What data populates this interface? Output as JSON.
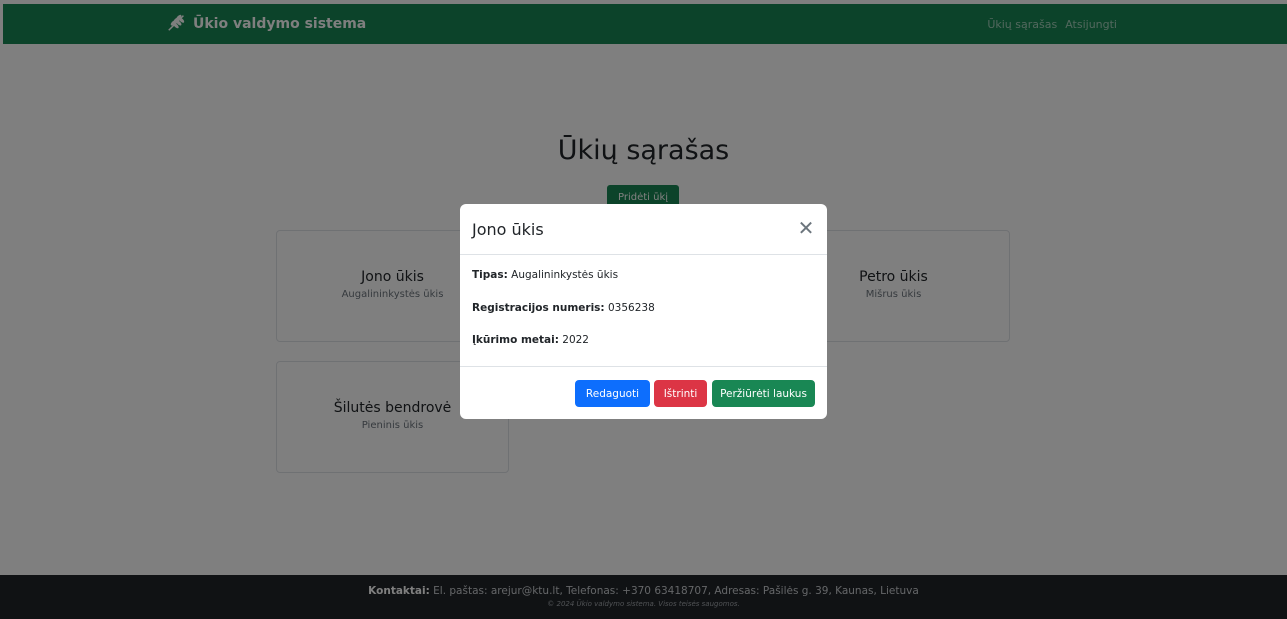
{
  "navbar": {
    "brand": "Ūkio valdymo sistema",
    "brand_icon": "wheat-icon",
    "links": [
      "Ūkių sąrašas",
      "Atsijungti"
    ]
  },
  "page": {
    "title": "Ūkių sąrašas",
    "add_button": "Pridėti ūkį"
  },
  "farms": [
    {
      "name": "Jono ūkis",
      "type": "Augalininkystės ūkis"
    },
    {
      "name": "Petro ūkis",
      "type": "Mišrus ūkis"
    },
    {
      "name": "Šilutės bendrovė",
      "type": "Pieninis ūkis"
    }
  ],
  "modal": {
    "title": "Jono ūkis",
    "close_icon": "close-icon",
    "fields": [
      {
        "label": "Tipas:",
        "value": "Augalininkystės ūkis"
      },
      {
        "label": "Registracijos numeris:",
        "value": "0356238"
      },
      {
        "label": "Įkūrimo metai:",
        "value": "2022"
      }
    ],
    "buttons": {
      "edit": "Redaguoti",
      "delete": "Ištrinti",
      "view_fields": "Peržiūrėti laukus"
    }
  },
  "footer": {
    "contacts_label": "Kontaktai:",
    "contacts_text": "El. paštas: arejur@ktu.lt, Telefonas: +370 63418707, Adresas: Pašilės g. 39, Kaunas, Lietuva",
    "copyright": "© 2024 Ūkio valdymo sistema. Visos teisės saugomos."
  },
  "colors": {
    "primary_green": "#198754",
    "primary_blue": "#0d6efd",
    "danger_red": "#dc3545",
    "footer_dark": "#212529"
  }
}
